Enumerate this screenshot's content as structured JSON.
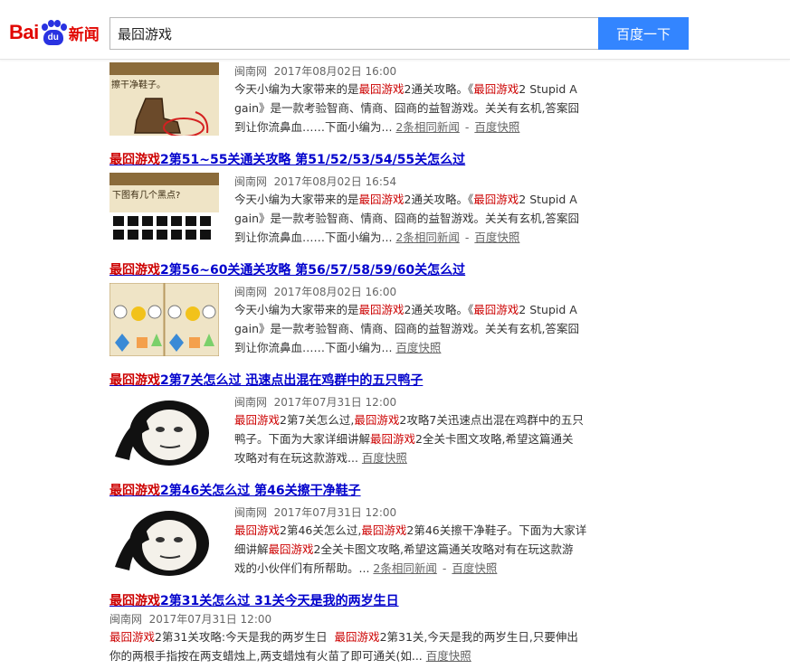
{
  "header": {
    "logo_text_bai": "Bai",
    "logo_text_du": "du",
    "logo_text_news": "新闻",
    "search_value": "最囧游戏",
    "search_button": "百度一下"
  },
  "results": [
    {
      "title_hl": "",
      "title_rest": "",
      "source": "闽南网",
      "date": "2017年08月02日 16:00",
      "body_lines": [
        {
          "t": "今天小编为大家带来的是"
        },
        {
          "em": "最囧游戏"
        },
        {
          "t": "2通关攻略。《"
        },
        {
          "em": "最囧游戏"
        },
        {
          "t": "2 Stupid Again》是一款考验智商、情商、囧商的益智游戏。关关有玄机,答案囧到让你流鼻血……下面小编为..."
        }
      ],
      "related": "2条相同新闻",
      "snapshot": "百度快照"
    },
    {
      "title_hl": "最囧游戏",
      "title_rest": "2第51~55关通关攻略 第51/52/53/54/55关怎么过",
      "source": "闽南网",
      "date": "2017年08月02日 16:54",
      "related": "2条相同新闻",
      "snapshot": "百度快照"
    },
    {
      "title_hl": "最囧游戏",
      "title_rest": "2第56~60关通关攻略 第56/57/58/59/60关怎么过",
      "source": "闽南网",
      "date": "2017年08月02日 16:00",
      "related": "",
      "snapshot": "百度快照"
    },
    {
      "title_hl": "最囧游戏",
      "title_rest": "2第7关怎么过 迅速点出混在鸡群中的五只鸭子",
      "source": "闽南网",
      "date": "2017年07月31日 12:00",
      "related": "",
      "snapshot": "百度快照"
    },
    {
      "title_hl": "最囧游戏",
      "title_rest": "2第46关怎么过 第46关擦干净鞋子",
      "source": "闽南网",
      "date": "2017年07月31日 12:00",
      "related": "2条相同新闻",
      "snapshot": "百度快照"
    },
    {
      "title_hl": "最囧游戏",
      "title_rest": "2第31关怎么过 31关今天是我的两岁生日",
      "source": "闽南网",
      "date": "2017年07月31日 12:00",
      "related": "",
      "snapshot": "百度快照"
    }
  ],
  "text": {
    "r0_a": "今天小编为大家带来的是",
    "r0_b": "2通关攻略。《",
    "r0_c": "2 Stupid A",
    "r0_d": "gain》是一款考验智商、情商、囧商的益智游戏。关关有玄机,答案囧",
    "r0_e": "到让你流鼻血……下面小编为...",
    "hl": "最囧游戏",
    "r3_a": "2第7关怎么过,",
    "r3_b": "2攻略7关迅速点出混在鸡群中的五只",
    "r3_c": "鸭子。下面为大家详细讲解",
    "r3_d": "2全关卡图文攻略,希望这篇通关",
    "r3_e": "攻略对有在玩这款游戏...",
    "r4_a": "2第46关怎么过,",
    "r4_b": "2第46关擦干净鞋子。下面为大家详",
    "r4_c": "细讲解",
    "r4_d": "2全关卡图文攻略,希望这篇通关攻略对有在玩这款游",
    "r4_e": "戏的小伙伴们有所帮助。...",
    "r5_a": "2第31关攻略:今天是我的两岁生日",
    "r5_b": "2第31关,今天是我的两岁生日,只要伸出",
    "r5_c": "你的两根手指按在两支蜡烛上,两支蜡烛有火苗了即可通关(如...",
    "dash": "-",
    "thumb0_text": "擦干净鞋子。",
    "thumb1_text": "下图有几个黑点?"
  }
}
